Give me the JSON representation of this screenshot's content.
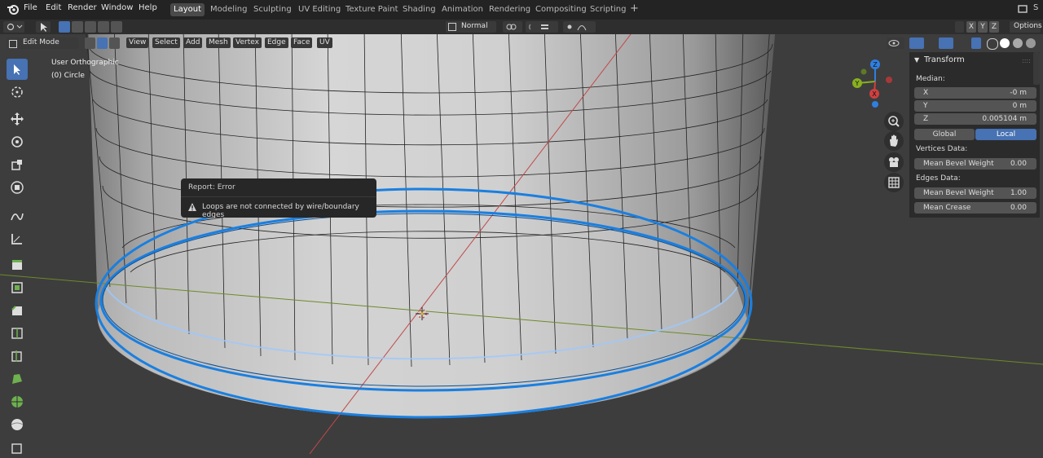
{
  "app": {
    "menus": [
      "File",
      "Edit",
      "Render",
      "Window",
      "Help"
    ],
    "workspaces": [
      "Layout",
      "Modeling",
      "Sculpting",
      "UV Editing",
      "Texture Paint",
      "Shading",
      "Animation",
      "Rendering",
      "Compositing",
      "Scripting"
    ],
    "active_workspace": "Layout",
    "add_workspace": "+",
    "user_initial": "S"
  },
  "header": {
    "mode": "Edit Mode",
    "view_menus": [
      "View",
      "Select",
      "Add",
      "Mesh",
      "Vertex",
      "Edge",
      "Face",
      "UV"
    ],
    "orientation": "Normal",
    "axes": [
      "X",
      "Y",
      "Z"
    ],
    "options": "Options"
  },
  "viewport": {
    "view_name": "User Orthographic",
    "object_name": "(0) Circle",
    "gizmo": {
      "z": "Z",
      "y": "Y",
      "x": "X"
    }
  },
  "report": {
    "title": "Report: Error",
    "message": "Loops are not connected by wire/boundary edges"
  },
  "transform": {
    "title": "Transform",
    "median_label": "Median:",
    "x": {
      "label": "X",
      "value": "-0 m"
    },
    "y": {
      "label": "Y",
      "value": "0 m"
    },
    "z": {
      "label": "Z",
      "value": "0.005104 m"
    },
    "global": "Global",
    "local": "Local",
    "vertices_label": "Vertices Data:",
    "vertex_bevel": {
      "label": "Mean Bevel Weight",
      "value": "0.00"
    },
    "edges_label": "Edges Data:",
    "edge_bevel": {
      "label": "Mean Bevel Weight",
      "value": "1.00"
    },
    "edge_crease": {
      "label": "Mean Crease",
      "value": "0.00"
    }
  },
  "colors": {
    "accent": "#4772b3",
    "selection": "#1a8cff",
    "x_axis": "#d04040",
    "y_axis": "#88b020",
    "z_axis": "#2f7fe0"
  }
}
